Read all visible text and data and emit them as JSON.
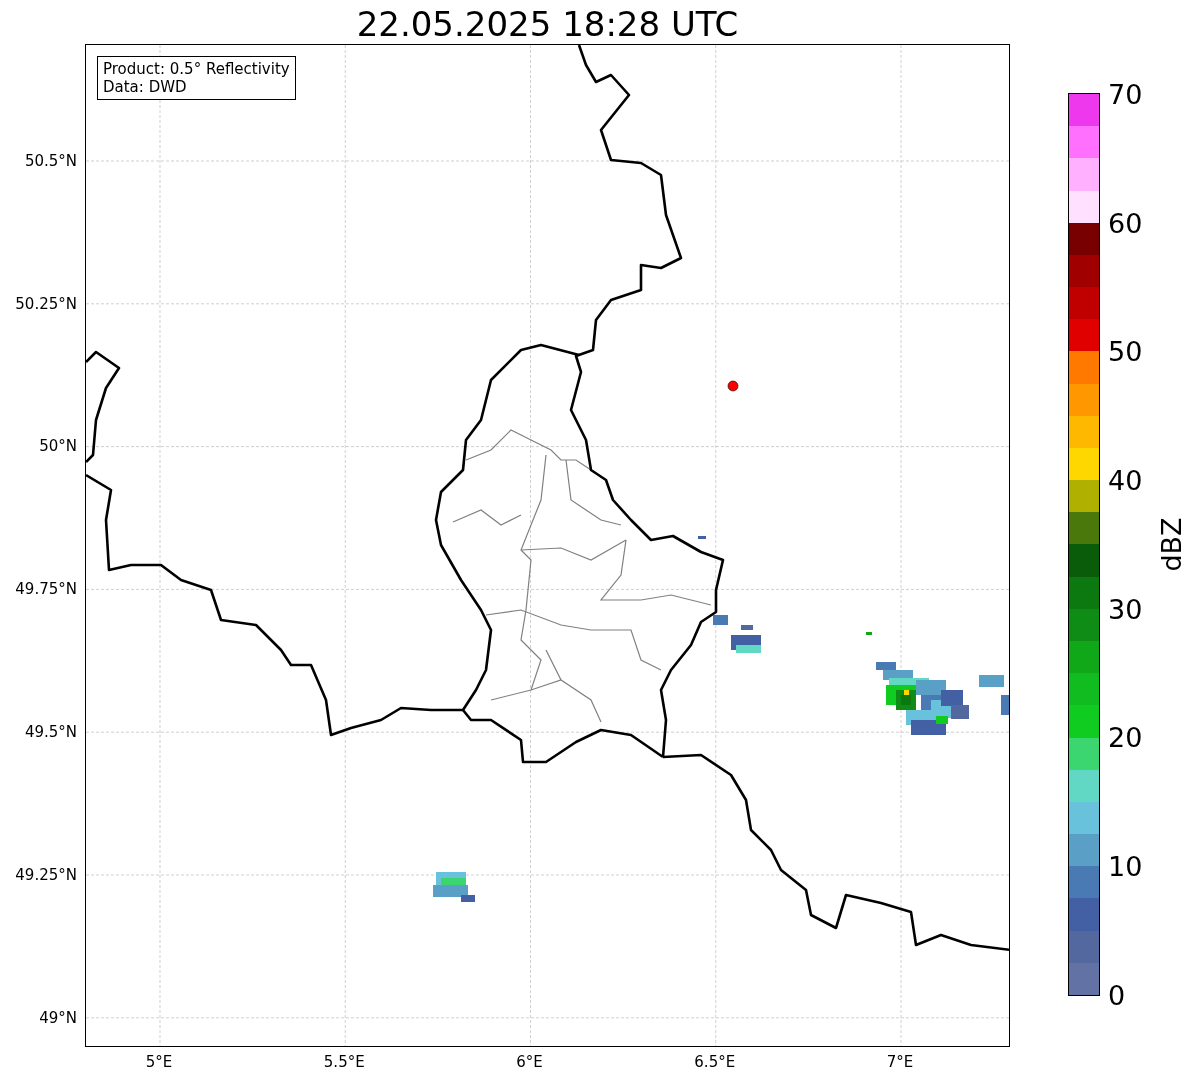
{
  "title": "22.05.2025 18:28 UTC",
  "legend": [
    "Product: 0.5° Reflectivity",
    "Data: DWD"
  ],
  "map": {
    "xticks": [
      "5°E",
      "5.5°E",
      "6°E",
      "6.5°E",
      "7°E"
    ],
    "yticks": [
      "50.5°N",
      "50.25°N",
      "50°N",
      "49.75°N",
      "49.5°N",
      "49.25°N",
      "49°N"
    ],
    "site_marker": {
      "color": "#ff0000"
    }
  },
  "colorbar": {
    "label": "dBZ",
    "ticks": [
      "70",
      "60",
      "50",
      "40",
      "30",
      "20",
      "10",
      "0"
    ],
    "bins": [
      {
        "color": "#6272a4"
      },
      {
        "color": "#5468a0"
      },
      {
        "color": "#4460a4"
      },
      {
        "color": "#4a7ab4"
      },
      {
        "color": "#5a9fc6"
      },
      {
        "color": "#68c2dc"
      },
      {
        "color": "#60d8c4"
      },
      {
        "color": "#3cd670"
      },
      {
        "color": "#10cc20"
      },
      {
        "color": "#10bc20"
      },
      {
        "color": "#10a818"
      },
      {
        "color": "#0e8c16"
      },
      {
        "color": "#0c7810"
      },
      {
        "color": "#0a5c0a"
      },
      {
        "color": "#4a780a"
      },
      {
        "color": "#b0b000"
      },
      {
        "color": "#ffd700"
      },
      {
        "color": "#ffb800"
      },
      {
        "color": "#ff9800"
      },
      {
        "color": "#ff7800"
      },
      {
        "color": "#e00000"
      },
      {
        "color": "#c00000"
      },
      {
        "color": "#a00000"
      },
      {
        "color": "#780000"
      },
      {
        "color": "#ffe0ff"
      },
      {
        "color": "#ffb0ff"
      },
      {
        "color": "#ff70ff"
      },
      {
        "color": "#ee38ee"
      }
    ]
  }
}
